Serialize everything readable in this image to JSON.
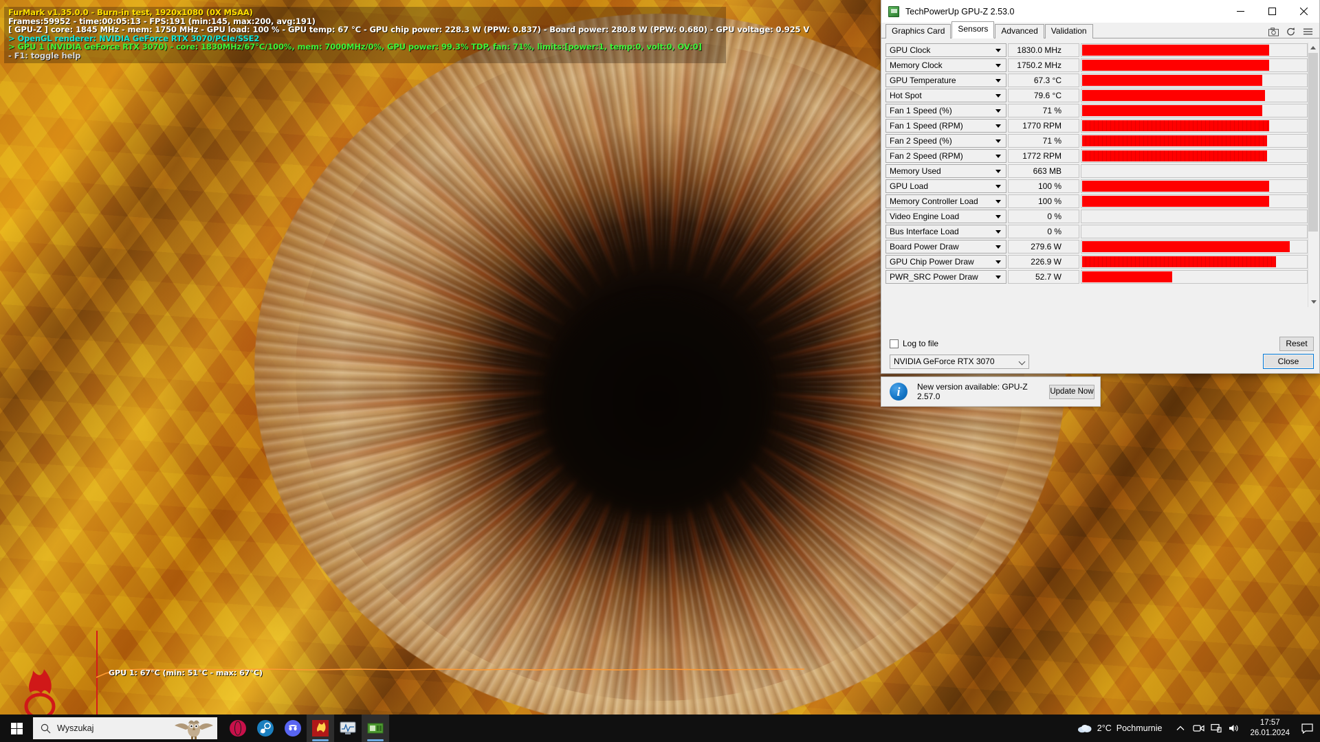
{
  "furmark": {
    "line1": "FurMark v1.35.0.0 - Burn-in test, 1920x1080 (0X MSAA)",
    "line2": "Frames:59952 - time:00:05:13 - FPS:191 (min:145, max:200, avg:191)",
    "line3": "[ GPU-Z ] core: 1845 MHz - mem: 1750 MHz - GPU load: 100 % - GPU temp: 67 °C - GPU chip power: 228.3 W (PPW: 0.837) - Board power: 280.8 W (PPW: 0.680) - GPU voltage: 0.925 V",
    "line4": "> OpenGL renderer: NVIDIA GeForce RTX 3070/PCIe/SSE2",
    "line5": "> GPU 1 (NVIDIA GeForce RTX 3070) - core: 1830MHz/67°C/100%, mem: 7000MHz/0%, GPU power: 99.3% TDP, fan: 71%, limits:[power:1, temp:0, volt:0, OV:0]",
    "line6": "- F1: toggle help",
    "graph_label": "GPU 1: 67°C (min: 51°C - max: 67°C)",
    "colors": {
      "title": "#ffe000",
      "stats": "#ffffff",
      "renderer": "#12e6d8",
      "gpu_line": "#3ef23a",
      "help": "#d8d8d8",
      "graph_axis": "#d61a1a"
    }
  },
  "gpuz": {
    "title": "TechPowerUp GPU-Z 2.53.0",
    "window_buttons": {
      "minimize": "—",
      "maximize": "▢",
      "close": "✕"
    },
    "tabs": [
      {
        "label": "Graphics Card",
        "active": false
      },
      {
        "label": "Sensors",
        "active": true
      },
      {
        "label": "Advanced",
        "active": false
      },
      {
        "label": "Validation",
        "active": false
      }
    ],
    "tab_icons": [
      "camera-icon",
      "refresh-icon",
      "menu-icon"
    ],
    "sensors": [
      {
        "name": "GPU Clock",
        "value": "1830.0 MHz",
        "bar": 83,
        "textured": false
      },
      {
        "name": "Memory Clock",
        "value": "1750.2 MHz",
        "bar": 83,
        "textured": false
      },
      {
        "name": "GPU Temperature",
        "value": "67.3 °C",
        "bar": 80,
        "textured": false
      },
      {
        "name": "Hot Spot",
        "value": "79.6 °C",
        "bar": 81,
        "textured": false
      },
      {
        "name": "Fan 1 Speed (%)",
        "value": "71 %",
        "bar": 80,
        "textured": false
      },
      {
        "name": "Fan 1 Speed (RPM)",
        "value": "1770 RPM",
        "bar": 83,
        "textured": true
      },
      {
        "name": "Fan 2 Speed (%)",
        "value": "71 %",
        "bar": 82,
        "textured": true
      },
      {
        "name": "Fan 2 Speed (RPM)",
        "value": "1772 RPM",
        "bar": 82,
        "textured": true
      },
      {
        "name": "Memory Used",
        "value": "663 MB",
        "bar": 0,
        "textured": false
      },
      {
        "name": "GPU Load",
        "value": "100 %",
        "bar": 83,
        "textured": false
      },
      {
        "name": "Memory Controller Load",
        "value": "100 %",
        "bar": 83,
        "textured": false
      },
      {
        "name": "Video Engine Load",
        "value": "0 %",
        "bar": 0,
        "textured": false
      },
      {
        "name": "Bus Interface Load",
        "value": "0 %",
        "bar": 0,
        "textured": false
      },
      {
        "name": "Board Power Draw",
        "value": "279.6 W",
        "bar": 92,
        "textured": false
      },
      {
        "name": "GPU Chip Power Draw",
        "value": "226.9 W",
        "bar": 86,
        "textured": true
      },
      {
        "name": "PWR_SRC Power Draw",
        "value": "52.7 W",
        "bar": 40,
        "textured": false
      }
    ],
    "log_to_file_label": "Log to file",
    "reset_label": "Reset",
    "gpu_selected": "NVIDIA GeForce RTX 3070",
    "close_label": "Close",
    "notification": {
      "text": "New version available: GPU-Z 2.57.0",
      "button": "Update Now",
      "icon": "info-icon"
    },
    "accent": "#ff0000"
  },
  "taskbar": {
    "start_label": "start-button",
    "search_placeholder": "Wyszukaj",
    "apps": [
      {
        "name": "opera",
        "color": "#c8104a"
      },
      {
        "name": "steam",
        "color": "#1b7fbf"
      },
      {
        "name": "discord",
        "color": "#5865f2"
      },
      {
        "name": "furmark",
        "color": "#b01818"
      },
      {
        "name": "hwmonitor",
        "color": "#8a98a8"
      },
      {
        "name": "gpuz",
        "color": "#4f9c32"
      }
    ],
    "weather": {
      "temp": "2°C",
      "condition": "Pochmurnie"
    },
    "tray_icons": [
      "chevron-up-icon",
      "camera-icon",
      "display-icon",
      "volume-icon"
    ],
    "clock": {
      "time": "17:57",
      "date": "26.01.2024"
    }
  }
}
